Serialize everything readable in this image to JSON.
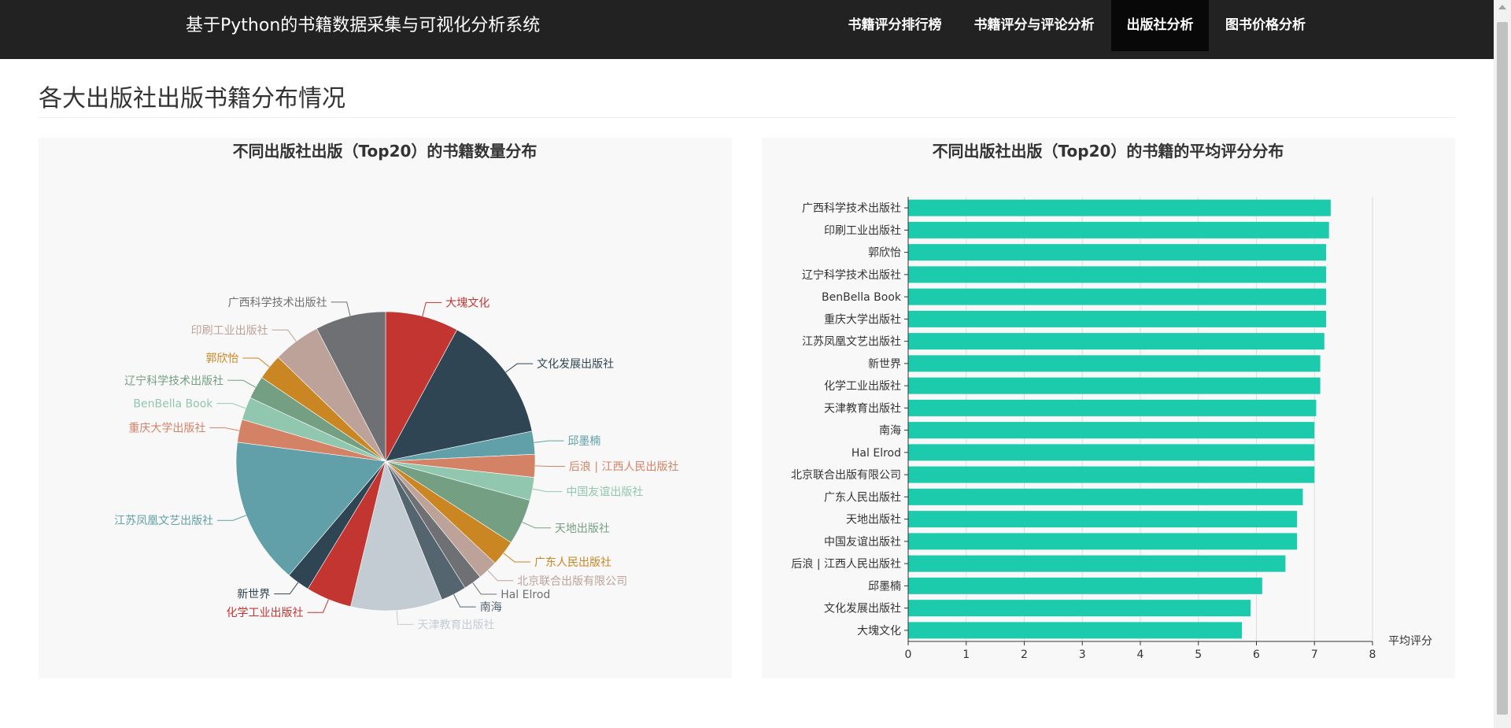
{
  "navbar": {
    "brand": "基于Python的书籍数据采集与可视化分析系统",
    "items": [
      {
        "label": "书籍评分排行榜",
        "active": false
      },
      {
        "label": "书籍评分与评论分析",
        "active": false
      },
      {
        "label": "出版社分析",
        "active": true
      },
      {
        "label": "图书价格分析",
        "active": false
      }
    ]
  },
  "page_title": "各大出版社出版书籍分布情况",
  "chart_data": [
    {
      "type": "pie",
      "title": "不同出版社出版（Top20）的书籍数量分布",
      "categories": [
        "大塊文化",
        "文化发展出版社",
        "邱墨楠",
        "后浪 | 江西人民出版社",
        "中国友谊出版社",
        "天地出版社",
        "广东人民出版社",
        "北京联合出版有限公司",
        "Hal Elrod",
        "南海",
        "天津教育出版社",
        "化学工业出版社",
        "新世界",
        "江苏凤凰文艺出版社",
        "重庆大学出版社",
        "BenBella Book",
        "辽宁科学技术出版社",
        "郭欣怡",
        "印刷工业出版社",
        "广西科学技术出版社"
      ],
      "values": [
        8.0,
        14.0,
        2.5,
        2.5,
        2.5,
        5.0,
        2.8,
        2.2,
        2.0,
        2.8,
        10.0,
        5.0,
        2.5,
        16.0,
        2.5,
        2.5,
        2.5,
        2.8,
        5.2,
        7.7
      ],
      "colors": [
        "#c23531",
        "#2f4554",
        "#61a0a8",
        "#d48265",
        "#91c7ae",
        "#749f83",
        "#ca8622",
        "#bda29a",
        "#6e7074",
        "#546570",
        "#c4ccd3",
        "#c23531",
        "#2f4554",
        "#61a0a8",
        "#d48265",
        "#91c7ae",
        "#749f83",
        "#ca8622",
        "#bda29a",
        "#6e7074"
      ]
    },
    {
      "type": "bar",
      "orientation": "horizontal",
      "title": "不同出版社出版（Top20）的书籍的平均评分分布",
      "categories": [
        "广西科学技术出版社",
        "印刷工业出版社",
        "郭欣怡",
        "辽宁科学技术出版社",
        "BenBella Book",
        "重庆大学出版社",
        "江苏凤凰文艺出版社",
        "新世界",
        "化学工业出版社",
        "天津教育出版社",
        "南海",
        "Hal Elrod",
        "北京联合出版有限公司",
        "广东人民出版社",
        "天地出版社",
        "中国友谊出版社",
        "后浪 | 江西人民出版社",
        "邱墨楠",
        "文化发展出版社",
        "大塊文化"
      ],
      "values": [
        7.28,
        7.25,
        7.2,
        7.2,
        7.2,
        7.2,
        7.17,
        7.1,
        7.1,
        7.03,
        7.0,
        7.0,
        7.0,
        6.8,
        6.7,
        6.7,
        6.5,
        6.1,
        5.9,
        5.75
      ],
      "xlabel": "平均评分",
      "xlim": [
        0,
        8
      ],
      "xticks": [
        "0",
        "1",
        "2",
        "3",
        "4",
        "5",
        "6",
        "7",
        "8"
      ],
      "bar_color": "#1bcbab",
      "grid": true
    }
  ]
}
